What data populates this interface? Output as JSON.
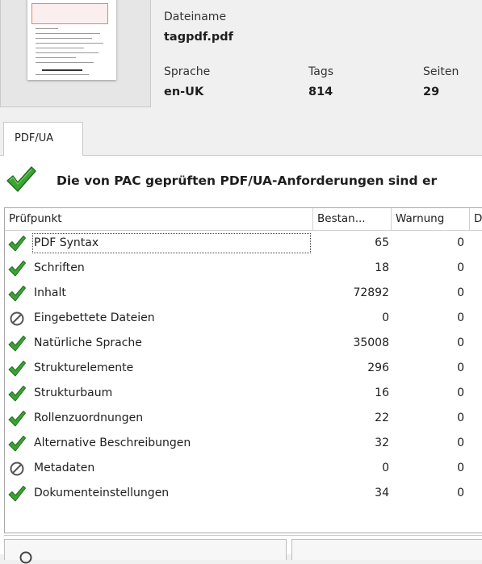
{
  "document": {
    "filename_label": "Dateiname",
    "filename": "tagpdf.pdf",
    "language_label": "Sprache",
    "language": "en-UK",
    "tags_label": "Tags",
    "tags": "814",
    "pages_label": "Seiten",
    "pages": "29"
  },
  "tabs": {
    "active": "PDF/UA"
  },
  "status": {
    "icon": "check-icon",
    "message": "Die von PAC geprüften PDF/UA-Anforderungen sind er"
  },
  "grid": {
    "columns": [
      "Prüfpunkt",
      "Bestan...",
      "Warnung",
      "D"
    ],
    "rows": [
      {
        "icon": "check-icon",
        "name": "PDF Syntax",
        "passed": "65",
        "warnings": "0"
      },
      {
        "icon": "check-icon",
        "name": "Schriften",
        "passed": "18",
        "warnings": "0"
      },
      {
        "icon": "check-icon",
        "name": "Inhalt",
        "passed": "72892",
        "warnings": "0"
      },
      {
        "icon": "not-applicable-icon",
        "name": "Eingebettete Dateien",
        "passed": "0",
        "warnings": "0"
      },
      {
        "icon": "check-icon",
        "name": "Natürliche Sprache",
        "passed": "35008",
        "warnings": "0"
      },
      {
        "icon": "check-icon",
        "name": "Strukturelemente",
        "passed": "296",
        "warnings": "0"
      },
      {
        "icon": "check-icon",
        "name": "Strukturbaum",
        "passed": "16",
        "warnings": "0"
      },
      {
        "icon": "check-icon",
        "name": "Rollenzuordnungen",
        "passed": "22",
        "warnings": "0"
      },
      {
        "icon": "check-icon",
        "name": "Alternative Beschreibungen",
        "passed": "32",
        "warnings": "0"
      },
      {
        "icon": "not-applicable-icon",
        "name": "Metadaten",
        "passed": "0",
        "warnings": "0"
      },
      {
        "icon": "check-icon",
        "name": "Dokumenteinstellungen",
        "passed": "34",
        "warnings": "0"
      }
    ]
  },
  "colors": {
    "check_green": "#3aa334",
    "check_dark": "#1f6b1c",
    "na_gray": "#555555"
  }
}
